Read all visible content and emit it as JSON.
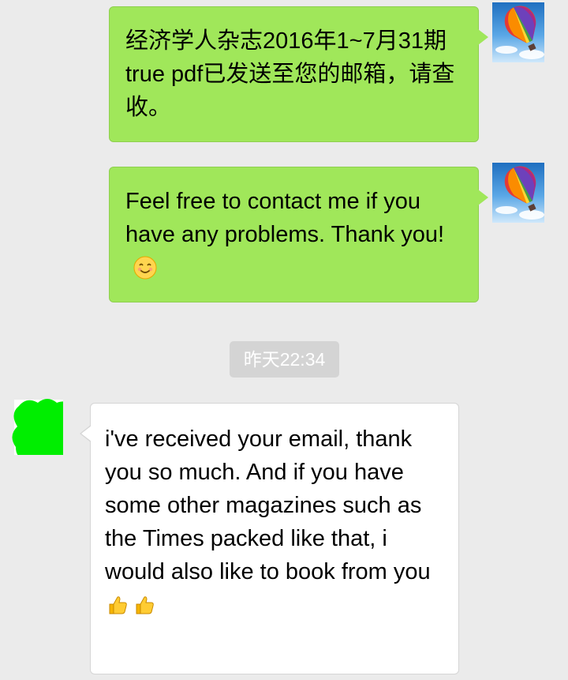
{
  "messages": [
    {
      "sender": "me",
      "text": "经济学人杂志2016年1~7月31期true pdf已发送至您的邮箱，请查收。"
    },
    {
      "sender": "me",
      "text": "Feel free to contact me if you have any problems. Thank you!",
      "emoji": "smiling-face"
    },
    {
      "sender": "other",
      "text": "i've received your email, thank you so much. And if you have some other magazines such as the Times packed like that, i would also like to book from you",
      "emoji": "thumbs-up x2"
    }
  ],
  "timestamp": "昨天22:34",
  "colors": {
    "background": "#ebebeb",
    "sent_bubble": "#a0e75a",
    "received_bubble": "#ffffff",
    "time_chip": "#d4d4d4"
  },
  "icons": {
    "my_avatar": "hot-air-balloon-avatar",
    "contact_avatar": "censored-green-avatar"
  }
}
